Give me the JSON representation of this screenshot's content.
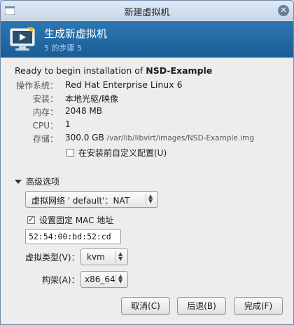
{
  "window": {
    "title": "新建虚拟机"
  },
  "banner": {
    "title": "生成新虚拟机",
    "step": "5 的步骤 5"
  },
  "summary": {
    "intro": "Ready to begin installation of ",
    "vm_name": "NSD-Example",
    "os_label": "操作系统：",
    "os_value": "Red Hat Enterprise Linux 6",
    "install_label": "安装：",
    "install_value": "本地光驱/映像",
    "memory_label": "内存：",
    "memory_value": "2048 MB",
    "cpu_label": "CPU：",
    "cpu_value": "1",
    "storage_label": "存储：",
    "storage_size": "300.0 GB",
    "storage_path": "/var/lib/libvirt/images/NSD-Example.img",
    "customize_label": "在安装前自定义配置(U)",
    "customize_checked": false
  },
  "advanced": {
    "title": "高级选项",
    "network_value": "虚拟网络 ' default'：NAT",
    "fixed_mac_label": "设置固定 MAC 地址",
    "fixed_mac_checked": true,
    "mac_value": "52:54:00:bd:52:cd",
    "virt_type_label": "虚拟类型(V)：",
    "virt_type_value": "kvm",
    "arch_label": "构架(A)：",
    "arch_value": "x86_64"
  },
  "buttons": {
    "cancel": "取消(C)",
    "back": "后退(B)",
    "finish": "完成(F)"
  },
  "colors": {
    "banner": "#1f66a3",
    "accent": "#2e77b3"
  }
}
